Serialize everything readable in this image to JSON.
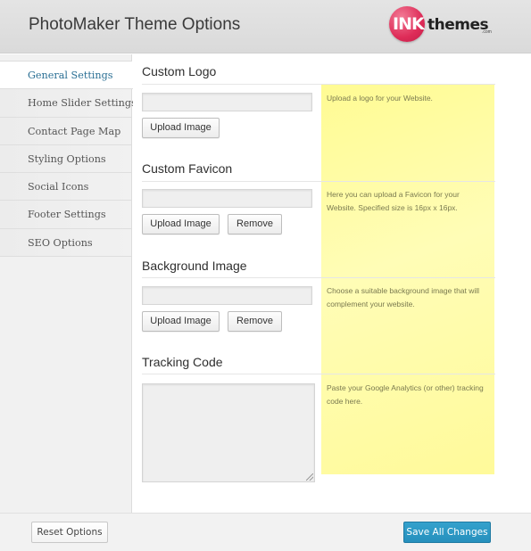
{
  "header": {
    "title": "PhotoMaker Theme Options",
    "logo": {
      "ink": "INK",
      "themes": "themes",
      "com": ".com",
      "brand_color": "#de2c58"
    }
  },
  "sidebar": {
    "items": [
      {
        "label": "General Settings",
        "active": true
      },
      {
        "label": "Home Slider Settings",
        "active": false
      },
      {
        "label": "Contact Page Map",
        "active": false
      },
      {
        "label": "Styling Options",
        "active": false
      },
      {
        "label": "Social Icons",
        "active": false
      },
      {
        "label": "Footer Settings",
        "active": false
      },
      {
        "label": "SEO Options",
        "active": false
      }
    ],
    "active_color": "#2a6f94"
  },
  "sections": {
    "logo": {
      "title": "Custom Logo",
      "value": "",
      "upload_label": "Upload Image",
      "help": "Upload a logo for your Website."
    },
    "favicon": {
      "title": "Custom Favicon",
      "value": "",
      "upload_label": "Upload Image",
      "remove_label": "Remove",
      "help": "Here you can upload a Favicon for your Website. Specified size is 16px x 16px."
    },
    "background": {
      "title": "Background Image",
      "value": "",
      "upload_label": "Upload Image",
      "remove_label": "Remove",
      "help": "Choose a suitable background image that will complement your website."
    },
    "tracking": {
      "title": "Tracking Code",
      "value": "",
      "help": "Paste your Google Analytics (or other) tracking code here."
    }
  },
  "footer": {
    "reset_label": "Reset Options",
    "save_label": "Save All Changes",
    "save_color": "#2690bd"
  },
  "colors": {
    "help_background": "#fffca8"
  }
}
